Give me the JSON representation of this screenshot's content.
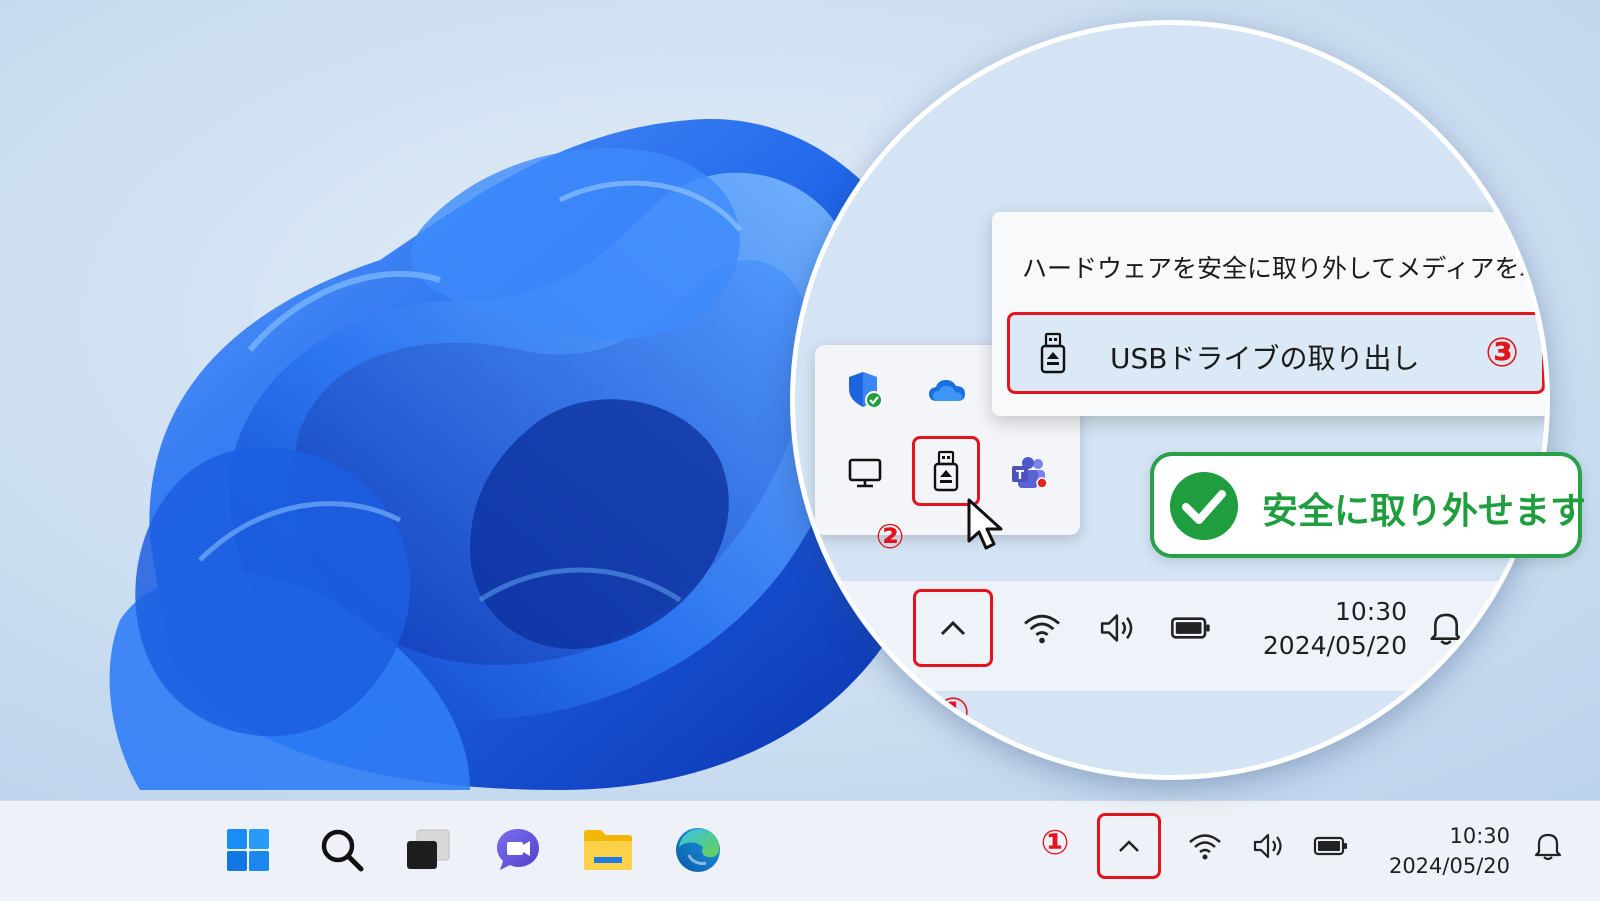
{
  "taskbar": {
    "pinned": [
      {
        "name": "start-button-icon"
      },
      {
        "name": "search-icon"
      },
      {
        "name": "task-view-icon"
      },
      {
        "name": "teams-chat-icon"
      },
      {
        "name": "file-explorer-icon"
      },
      {
        "name": "edge-icon"
      }
    ],
    "tray": {
      "time": "10:30",
      "date": "2024/05/20",
      "icons": [
        "chevron-up-icon",
        "wifi-icon",
        "volume-icon",
        "battery-icon",
        "notification-bell-icon"
      ]
    }
  },
  "magnified": {
    "time": "10:30",
    "date": "2024/05/20"
  },
  "context_menu": {
    "title": "ハードウェアを安全に取り外してメディアを取り出す",
    "item_label": "USBドライブの取り出し"
  },
  "overflow_icons": [
    "defender-shield-icon",
    "onedrive-cloud-icon",
    "monitor-icon",
    "usb-drive-icon",
    "teams-icon"
  ],
  "callout": {
    "text": "安全に取り外せます"
  },
  "step_badges": {
    "one": "①",
    "two": "②",
    "three": "③"
  },
  "colors": {
    "highlight_red": "#e3141b",
    "success_green": "#1f9d3f",
    "accent_blue": "#1a66e8"
  }
}
